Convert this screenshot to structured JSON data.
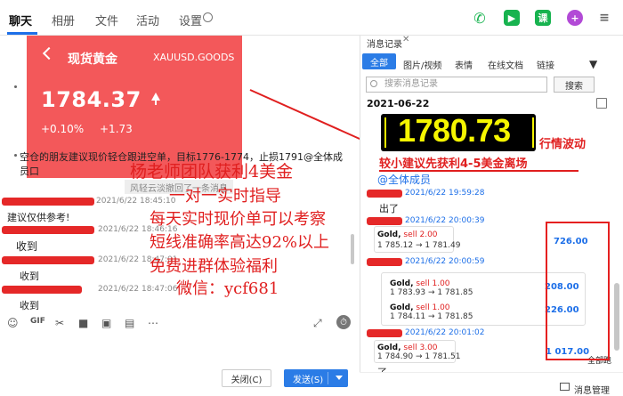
{
  "top_tabs": [
    "聊天",
    "相册",
    "文件",
    "活动",
    "设置"
  ],
  "top_icons": [
    "phone-icon",
    "video-icon",
    "class-icon",
    "add-icon"
  ],
  "top_icon_labels": {
    "class": "课",
    "add": "+"
  },
  "top_icon_colors": {
    "phone": "#17b34f",
    "video": "#17b34f",
    "class": "#17b34f",
    "add": "#b24ad6"
  },
  "gold_card": {
    "title": "现货黄金",
    "symbol": "XAUUSD.GOODS",
    "price": "1784.37",
    "change_pct": "+0.10%",
    "change": "+1.73",
    "color": "#f3585a"
  },
  "messages": {
    "advice": "空仓的朋友建议现价轻仓跟进空单，目标1776-1774，止损1791@全体成",
    "advice_2": "员口",
    "sys_note": "风轻云淡撤回了一条消息",
    "m1_time": "2021/6/22 18:45:10",
    "m1_text": "建议仅供参考!",
    "m2_time": "2021/6/22 18:46:16",
    "m2_text": "收到",
    "m3_time": "2021/6/22 18:47:01",
    "m3_text": "收到",
    "m4_time": "2021/6/22 18:47:06",
    "m4_text": "收到"
  },
  "overlay_left": [
    "杨老师团队获利4美金",
    "一对一实时指导",
    "每天实时现价单可以考察",
    "短线准确率高达92%以上",
    "免费进群体验福利",
    "微信：ycf681"
  ],
  "toolbar_icons": [
    "emoji-icon",
    "gif-icon",
    "scissors-icon",
    "folder-icon",
    "image-icon",
    "screen-icon",
    "more-icon"
  ],
  "toolbar_labels": {
    "gif": "GIF"
  },
  "buttons": {
    "close": "关闭(C)",
    "send": "发送(S)"
  },
  "history": {
    "title": "消息记录",
    "tabs": [
      "全部",
      "图片/视频",
      "表情",
      "在线文档",
      "链接"
    ],
    "search_placeholder": "搜索消息记录",
    "search_btn": "搜索",
    "date": "2021-06-22",
    "ticker": "1780.73",
    "overlay_1": "行情波动",
    "overlay_2": "较小建议先获利4-5美金离场",
    "mention": "@全体成员",
    "h1_time": "2021/6/22 19:59:28",
    "h1_text": "出了",
    "h2_time": "2021/6/22 20:00:39",
    "t1_line1_a": "Gold,",
    "t1_line1_b": "sell 2.00",
    "t1_line2": "1 785.12 → 1 781.49",
    "t1_val": "726.00",
    "h3_time": "2021/6/22 20:00:59",
    "t2_line1_a": "Gold,",
    "t2_line1_b": "sell 1.00",
    "t2_line2": "1 783.93 → 1 781.85",
    "t2_val": "208.00",
    "t3_line1_a": "Gold,",
    "t3_line1_b": "sell 1.00",
    "t3_line2": "1 784.11 → 1 781.85",
    "t3_val": "226.00",
    "h4_time": "2021/6/22 20:01:02",
    "t4_line1_a": "Gold,",
    "t4_line1_b": "sell 3.00",
    "t4_line2": "1 784.90 → 1 781.51",
    "t4_val": "1 017.00",
    "h4_text": "了",
    "h4_tail": "全部跑",
    "footer": "消息管理"
  }
}
